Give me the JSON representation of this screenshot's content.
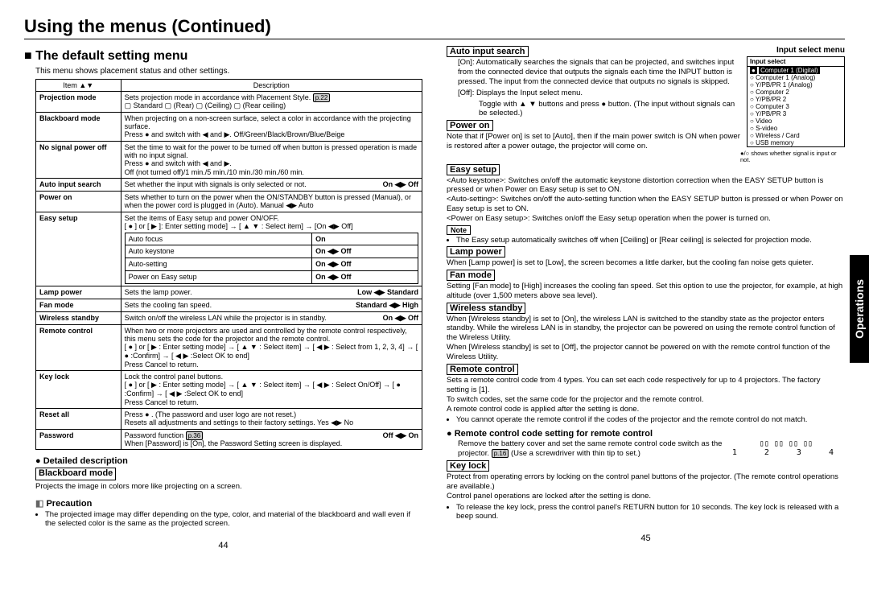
{
  "header": {
    "main_title": "Using the menus (Continued)",
    "section_title": "The default setting menu",
    "intro": "This menu shows placement status and other settings."
  },
  "table": {
    "col_item": "Item ▲▼",
    "col_desc": "Description",
    "rows": {
      "projection_mode_item": "Projection mode",
      "projection_mode_desc": "Sets projection mode in accordance with Placement Style.",
      "projection_mode_ref": "p.22",
      "projection_mode_opts": "▢ Standard  ▢ (Rear)  ▢ (Ceiling)  ▢ (Rear ceiling)",
      "blackboard_item": "Blackboard mode",
      "blackboard_desc": "When projecting on a non-screen surface, select a color in accordance with the projecting surface.\nPress ● and switch with ◀ and ▶. Off/Green/Black/Brown/Blue/Beige",
      "nosignal_item": "No signal power off",
      "nosignal_desc": "Set the time to wait for the power to be turned off when button is pressed operation is made with no input signal.\nPress ● and switch with ◀ and ▶.\nOff (not turned off)/1 min./5 min./10 min./30 min./60 min.",
      "autoinput_item": "Auto input search",
      "autoinput_desc": "Set whether the input with signals is only selected or not.",
      "autoinput_toggle": "On ◀▶ Off",
      "poweron_item": "Power on",
      "poweron_desc": "Sets whether to turn on the power when the ON/STANDBY button is pressed (Manual), or when the power cord is plugged in (Auto).   Manual ◀▶ Auto",
      "easysetup_item": "Easy setup",
      "easysetup_desc": "Set the items of Easy setup and power ON/OFF.\n[ ● ] or [ ▶ ]: Enter setting mode] → [ ▲ ▼ : Select item] → [On ◀▶ Off]",
      "easy_r1a": "Auto focus",
      "easy_r1b": "On",
      "easy_r2a": "Auto keystone",
      "easy_r2b": "On ◀▶ Off",
      "easy_r3a": "Auto-setting",
      "easy_r3b": "On ◀▶ Off",
      "easy_r4a": "Power on Easy setup",
      "easy_r4b": "On ◀▶ Off",
      "lamp_item": "Lamp power",
      "lamp_desc": "Sets the lamp power.",
      "lamp_toggle": "Low ◀▶ Standard",
      "fan_item": "Fan mode",
      "fan_desc": "Sets the cooling fan speed.",
      "fan_toggle": "Standard ◀▶ High",
      "wireless_item": "Wireless standby",
      "wireless_desc": "Switch on/off the wireless LAN while the projector is in standby.",
      "wireless_toggle": "On ◀▶ Off",
      "remote_item": "Remote control",
      "remote_desc": "When two or more projectors are used and controlled by the remote control respectively, this menu sets the code for the projector and the remote control.\n[ ● ] or [ ▶ : Enter setting mode] → [ ▲ ▼ : Select item] → [ ◀ ▶ : Select from 1, 2, 3, 4] → [ ● :Confirm] → [ ◀ ▶ :Select OK to end]\nPress Cancel to return.",
      "keylock_item": "Key lock",
      "keylock_desc": "Lock the control panel buttons.\n[ ● ] or [ ▶ : Enter setting mode] → [ ▲ ▼ : Select item] → [ ◀ ▶ : Select On/Off] → [ ● :Confirm] → [ ◀ ▶ :Select OK to end]\nPress Cancel to return.",
      "reset_item": "Reset all",
      "reset_desc": "Press ● . (The password and user logo are not reset.)\nResets all adjustments and settings to their factory settings.   Yes ◀▶ No",
      "password_item": "Password",
      "password_desc1": "Password function",
      "password_ref": "p.36",
      "password_toggle": "Off ◀▶ On",
      "password_desc2": "When [Password] is [On], the Password Setting screen is displayed."
    }
  },
  "detailed": {
    "head": "Detailed description",
    "blackboard_label": "Blackboard mode",
    "blackboard_text": "Projects the image in colors more like projecting on a screen.",
    "precaution_head": "Precaution",
    "precaution_text": "The projected image may differ depending on the type, color, and material of the blackboard and wall even if the selected color is the same as the projected screen."
  },
  "right": {
    "autoinput_head": "Auto input search",
    "autoinput_on": "[On]: Automatically searches the signals that can be projected, and switches input from the connected device that outputs the signals each time the INPUT button is pressed. The input from the connected device that outputs no signals is skipped.",
    "autoinput_off": "[Off]: Displays the Input select menu.",
    "autoinput_toggle": "Toggle with ▲ ▼ buttons and press ● button. (The input without signals can be selected.)",
    "inputselect_caption": "Input select menu",
    "inputselect_header": "Input select",
    "inputselect_items": [
      "Computer 1 (Digital)",
      "Computer 1 (Analog)",
      "Y/PB/PR 1 (Analog)",
      "Computer 2",
      "Y/PB/PR 2",
      "Computer 3",
      "Y/PB/PR 3",
      "Video",
      "S-video",
      "Wireless / Card",
      "USB memory"
    ],
    "inputselect_note": "●/○ shows whether signal is input or not.",
    "poweron_head": "Power on",
    "poweron_text": "Note that if [Power on] is set to [Auto], then if the main power switch is ON when power is restored after a power outage, the projector will come on.",
    "easysetup_head": "Easy setup",
    "easysetup_text": "<Auto keystone>: Switches on/off the automatic keystone distortion correction when the EASY SETUP button is pressed or when Power on Easy setup is set to ON.\n<Auto-setting>: Switches on/off the auto-setting function when the EASY SETUP button is pressed or when Power on Easy setup is set to ON.\n<Power on Easy setup>: Switches on/off the Easy setup operation when the power is turned on.",
    "note_label": "Note",
    "easysetup_note": "The Easy setup automatically switches off when [Ceiling] or [Rear ceiling] is selected for projection mode.",
    "lamp_head": "Lamp power",
    "lamp_text": "When [Lamp power] is set to [Low], the screen becomes a little darker, but the cooling fan noise gets quieter.",
    "fan_head": "Fan mode",
    "fan_text": "Setting [Fan mode] to [High] increases the cooling fan speed. Set this option to use the projector, for example, at high altitude (over 1,500 meters above sea level).",
    "wireless_head": "Wireless standby",
    "wireless_text": "When [Wireless standby] is set to [On], the wireless LAN is switched to the standby state as the projector enters standby. While the wireless LAN is in standby, the projector can be powered on using the remote control function of the Wireless Utility.\nWhen [Wireless standby] is set to [Off], the projector cannot be powered on with the remote control function of the Wireless Utility.",
    "remote_head": "Remote control",
    "remote_text": "Sets a remote control code from 4 types. You can set each code respectively for up to 4 projectors. The factory setting is [1].\nTo switch codes, set the same code for the projector and the remote control.\nA remote control code is applied after the setting is done.",
    "remote_bullet": "You cannot operate the remote control if the codes of the projector and the remote control do not match.",
    "remote_code_head": "Remote control code setting for remote control",
    "remote_code_text": "Remove the battery cover and set the same remote control code switch as the projector.",
    "remote_code_ref": "p.16",
    "remote_code_hint": "(Use a screwdriver with thin tip to set.)",
    "remote_nums": "1  2  3  4",
    "keylock_head": "Key lock",
    "keylock_text": "Protect from operating errors by locking on the control panel buttons of the projector. (The remote control operations are available.)\nControl panel operations are locked after the setting is done.",
    "keylock_bullet": "To release the key lock, press the control panel's RETURN button for 10 seconds. The key lock is released with a beep sound."
  },
  "side_tab": "Operations",
  "page_left": "44",
  "page_right": "45"
}
